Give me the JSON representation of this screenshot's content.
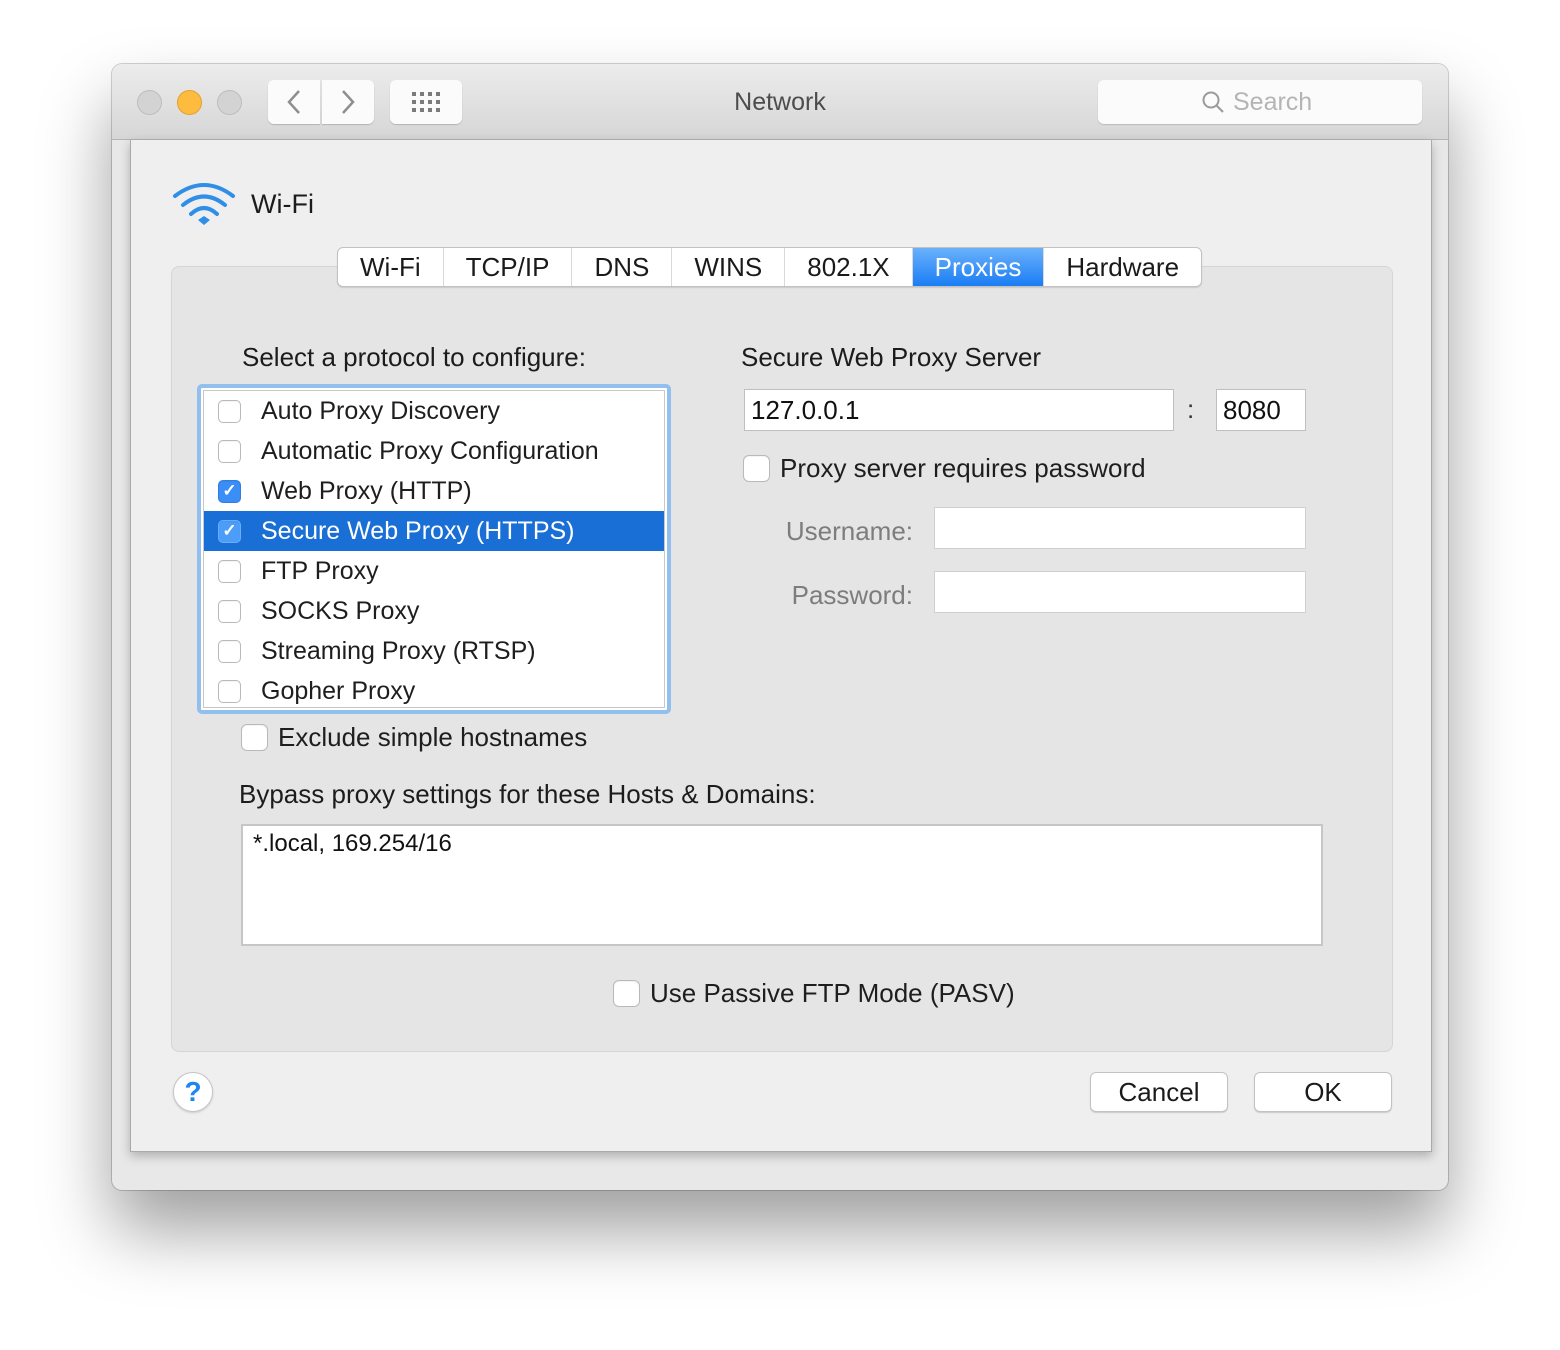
{
  "window": {
    "title": "Network",
    "search_placeholder": "Search",
    "traffic_lights": {
      "close_color": "#d3d3d3",
      "minimize_color": "#fdbc40",
      "zoom_color": "#d3d3d3"
    }
  },
  "sheet": {
    "interface_name": "Wi-Fi",
    "tabs": [
      {
        "label": "Wi-Fi",
        "active": false
      },
      {
        "label": "TCP/IP",
        "active": false
      },
      {
        "label": "DNS",
        "active": false
      },
      {
        "label": "WINS",
        "active": false
      },
      {
        "label": "802.1X",
        "active": false
      },
      {
        "label": "Proxies",
        "active": true
      },
      {
        "label": "Hardware",
        "active": false
      }
    ],
    "protocol_heading": "Select a protocol to configure:",
    "protocols": [
      {
        "label": "Auto Proxy Discovery",
        "checked": false,
        "selected": false
      },
      {
        "label": "Automatic Proxy Configuration",
        "checked": false,
        "selected": false
      },
      {
        "label": "Web Proxy (HTTP)",
        "checked": true,
        "selected": false
      },
      {
        "label": "Secure Web Proxy (HTTPS)",
        "checked": true,
        "selected": true
      },
      {
        "label": "FTP Proxy",
        "checked": false,
        "selected": false
      },
      {
        "label": "SOCKS Proxy",
        "checked": false,
        "selected": false
      },
      {
        "label": "Streaming Proxy (RTSP)",
        "checked": false,
        "selected": false
      },
      {
        "label": "Gopher Proxy",
        "checked": false,
        "selected": false
      }
    ],
    "server": {
      "heading": "Secure Web Proxy Server",
      "host": "127.0.0.1",
      "separator": ":",
      "port": "8080",
      "requires_password_label": "Proxy server requires password",
      "requires_password": false,
      "username_label": "Username:",
      "username": "",
      "password_label": "Password:",
      "password": ""
    },
    "exclude_simple_hostnames_label": "Exclude simple hostnames",
    "exclude_simple_hostnames": false,
    "bypass_label": "Bypass proxy settings for these Hosts & Domains:",
    "bypass_value": "*.local, 169.254/16",
    "passive_ftp_label": "Use Passive FTP Mode (PASV)",
    "passive_ftp": false,
    "help_label": "?",
    "cancel_label": "Cancel",
    "ok_label": "OK"
  },
  "colors": {
    "accent": "#1a7df4",
    "selection": "#1a6fd6",
    "focus_ring": "#93bfef",
    "wifi_icon": "#2f8fe8"
  },
  "check_glyph": "✓"
}
